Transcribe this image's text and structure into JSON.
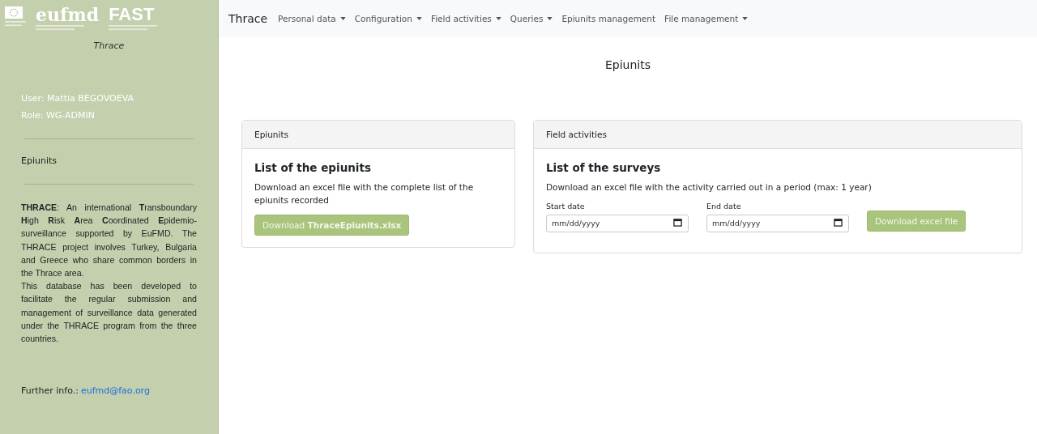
{
  "logos": [
    {
      "kind": "eu"
    },
    {
      "kind": "eufmd",
      "wordmark": "eufmd"
    },
    {
      "kind": "fast",
      "wordmark": "FAST"
    }
  ],
  "sidebar": {
    "project": "Thrace",
    "user": "User: Mattia BEGOVOEVA",
    "role": "Role: WG-ADMIN",
    "section": "Epiunits",
    "about": [
      "**THRACE**: An international **T**ransboundary **H**igh **R**isk **A**rea **C**oordinated **E**pidemio-surveillance supported by EuFMD. The THRACE project involves Turkey, Bulgaria and Greece who share common borders in the Thrace area.",
      "This database has been developed to facilitate the regular submission and management of surveillance data generated under the THRACE program from the three countries."
    ],
    "further_label": "Further info.:",
    "further_link": "eufmd@fao.org"
  },
  "navbar": {
    "brand": "Thrace",
    "items": [
      {
        "label": "Personal data",
        "dropdown": true
      },
      {
        "label": "Configuration",
        "dropdown": true
      },
      {
        "label": "Field activities",
        "dropdown": true
      },
      {
        "label": "Queries",
        "dropdown": true
      },
      {
        "label": "Epiunits management",
        "dropdown": false
      },
      {
        "label": "File management",
        "dropdown": true
      }
    ]
  },
  "page_title": "Epiunits",
  "cards": [
    {
      "header": "Epiunits",
      "title": "List of the epiunits",
      "text": "Download an excel file with the complete list of the epiunits recorded",
      "button": "Download **ThraceEpiunits.xlsx**"
    },
    {
      "header": "Field activities",
      "title": "List of the surveys",
      "text": "Download an excel file with the activity carried out in a period (max: 1 year)",
      "fields": [
        {
          "label": "Start date",
          "placeholder": "mm/dd/yyyy"
        },
        {
          "label": "End date",
          "placeholder": "mm/dd/yyyy"
        }
      ],
      "button": "Download excel file"
    }
  ]
}
